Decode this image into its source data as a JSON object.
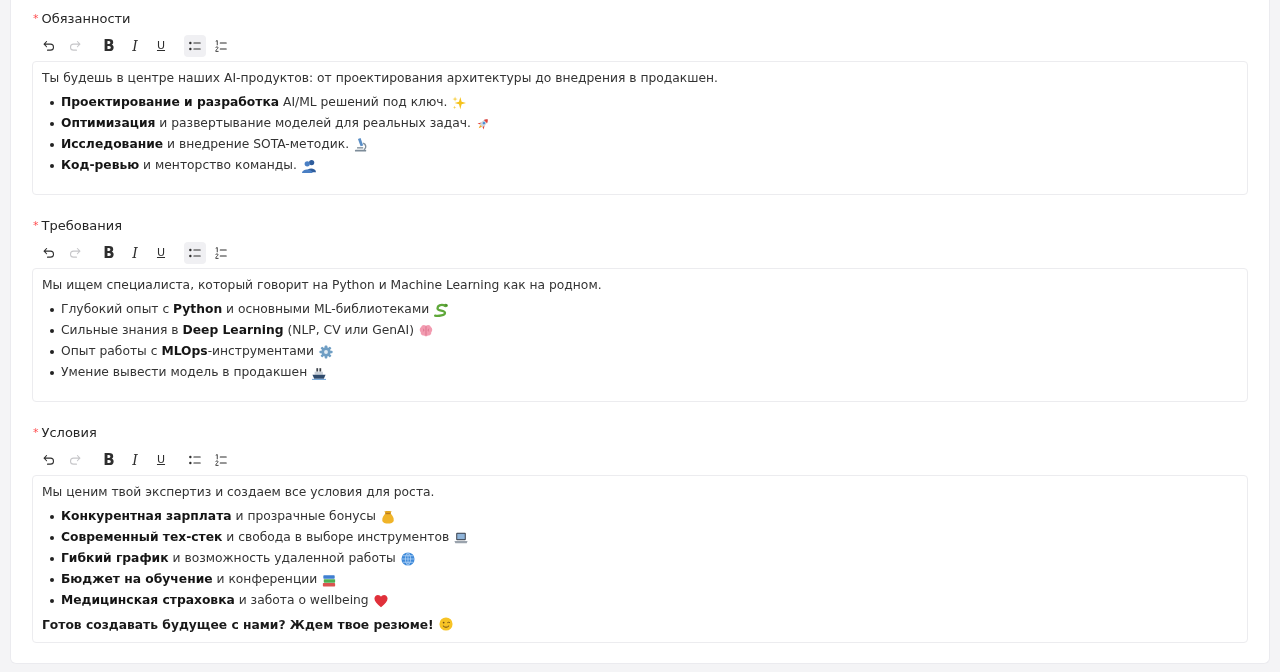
{
  "sections": [
    {
      "required_mark": "*",
      "label": "Обязанности",
      "toolbar": [
        [
          {
            "kind": "undo",
            "disabled": false,
            "active": false
          },
          {
            "kind": "redo",
            "disabled": true,
            "active": false
          }
        ],
        [
          {
            "kind": "bold",
            "glyph": "B",
            "disabled": false,
            "active": false
          },
          {
            "kind": "italic",
            "glyph": "I",
            "disabled": false,
            "active": false
          },
          {
            "kind": "underline",
            "glyph": "U",
            "disabled": false,
            "active": false
          }
        ],
        [
          {
            "kind": "bullet-list",
            "disabled": false,
            "active": true
          },
          {
            "kind": "numbered-list",
            "disabled": false,
            "active": false
          }
        ]
      ],
      "editor": {
        "content": [
          {
            "kind": "paragraph",
            "bold": false,
            "text": "Ты будешь в центре наших AI-продуктов: от проектирования архитектуры до внедрения в продакшен."
          },
          {
            "kind": "bullets",
            "items": [
              {
                "text": "**Проектирование и разработка** AI/ML решений под ключ."
              },
              {
                "text": "**Оптимизация** и развертывание моделей для реальных задач."
              },
              {
                "text": "**Исследование** и внедрение SOTA-методик."
              },
              {
                "text": "**Код-ревью** и менторство команды."
              }
            ]
          }
        ]
      }
    },
    {
      "required_mark": "*",
      "label": "Требования",
      "toolbar": [
        [
          {
            "kind": "undo",
            "disabled": false,
            "active": false
          },
          {
            "kind": "redo",
            "disabled": true,
            "active": false
          }
        ],
        [
          {
            "kind": "bold",
            "glyph": "B",
            "disabled": false,
            "active": false
          },
          {
            "kind": "italic",
            "glyph": "I",
            "disabled": false,
            "active": false
          },
          {
            "kind": "underline",
            "glyph": "U",
            "disabled": false,
            "active": false
          }
        ],
        [
          {
            "kind": "bullet-list",
            "disabled": false,
            "active": true
          },
          {
            "kind": "numbered-list",
            "disabled": false,
            "active": false
          }
        ]
      ],
      "editor": {
        "content": [
          {
            "kind": "paragraph",
            "bold": false,
            "text": "Мы ищем специалиста, который говорит на Python и Machine Learning как на родном."
          },
          {
            "kind": "bullets",
            "items": [
              {
                "text": "Глубокий опыт с **Python** и основными ML-библиотеками"
              },
              {
                "text": "Сильные знания в **Deep Learning** (NLP, CV или GenAI)"
              },
              {
                "text": "Опыт работы с **MLOps**-инструментами"
              },
              {
                "text": "Умение вывести модель в продакшен"
              }
            ]
          }
        ]
      }
    },
    {
      "required_mark": "*",
      "label": "Условия",
      "toolbar": [
        [
          {
            "kind": "undo",
            "disabled": false,
            "active": false
          },
          {
            "kind": "redo",
            "disabled": true,
            "active": false
          }
        ],
        [
          {
            "kind": "bold",
            "glyph": "B",
            "disabled": false,
            "active": false
          },
          {
            "kind": "italic",
            "glyph": "I",
            "disabled": false,
            "active": false
          },
          {
            "kind": "underline",
            "glyph": "U",
            "disabled": false,
            "active": false
          }
        ],
        [
          {
            "kind": "bullet-list",
            "disabled": false,
            "active": false
          },
          {
            "kind": "numbered-list",
            "disabled": false,
            "active": false
          }
        ]
      ],
      "editor": {
        "content": [
          {
            "kind": "paragraph",
            "bold": false,
            "text": "Мы ценим твой экспертиз и создаем все условия для роста."
          },
          {
            "kind": "bullets",
            "items": [
              {
                "text": "**Конкурентная зарплата** и прозрачные бонусы"
              },
              {
                "text": "**Современный тех-стек** и свобода в выборе инструментов"
              },
              {
                "text": "**Гибкий график** и возможность удаленной работы"
              },
              {
                "text": "**Бюджет на обучение** и конференции"
              },
              {
                "text": "**Медицинская страховка** и забота о wellbeing"
              }
            ]
          },
          {
            "kind": "paragraph",
            "bold": true,
            "text": "Готов создавать будущее с нами? Ждем твое резюме!"
          }
        ]
      }
    }
  ]
}
